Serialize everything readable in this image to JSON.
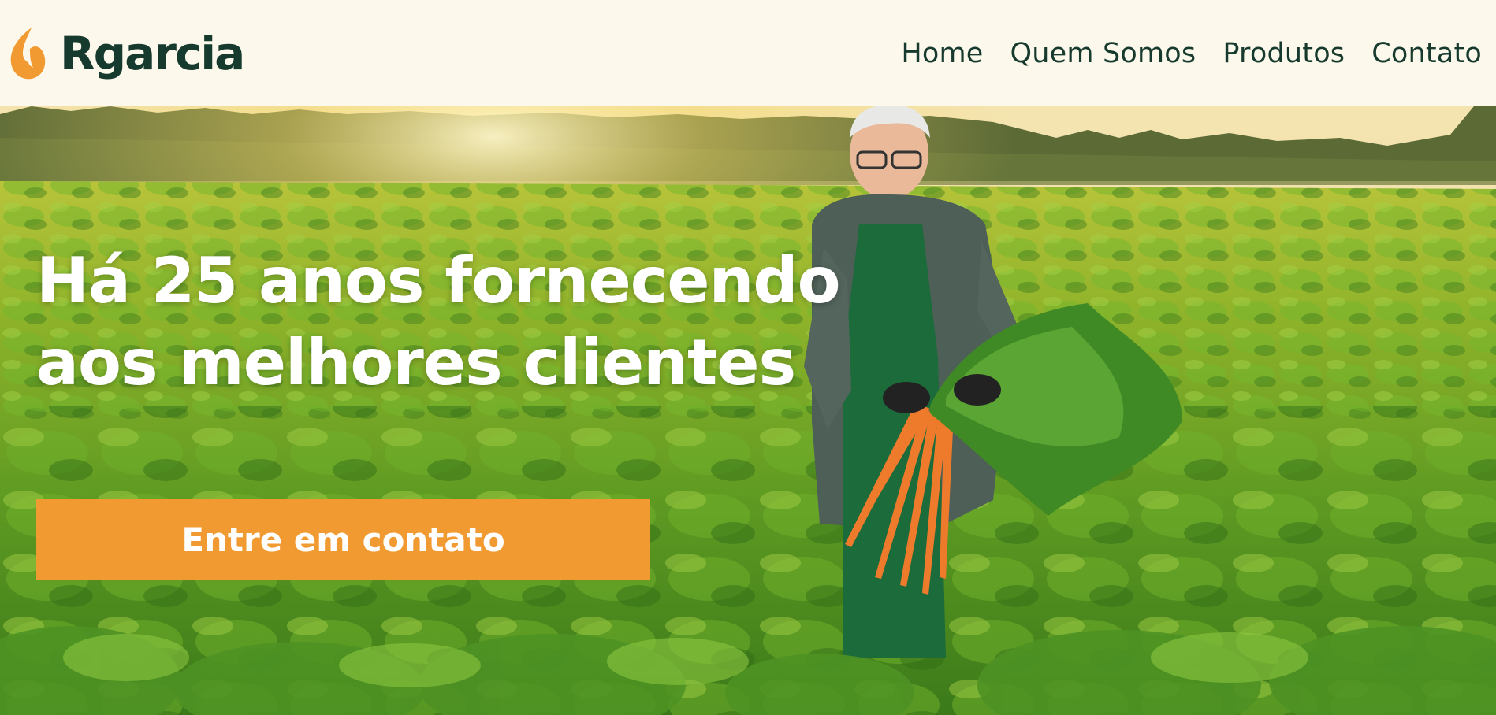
{
  "brand": {
    "name": "Rgarcia",
    "icon": "flame-leaf-icon",
    "icon_color": "#f29a32",
    "text_color": "#163a2d"
  },
  "nav": {
    "items": [
      {
        "label": "Home"
      },
      {
        "label": "Quem Somos"
      },
      {
        "label": "Produtos"
      },
      {
        "label": "Contato"
      }
    ]
  },
  "hero": {
    "title": "Há 25 anos fornecendo aos melhores clientes",
    "cta_label": "Entre em contato",
    "cta_color": "#f29a32"
  },
  "colors": {
    "header_bg": "#fdf8ec",
    "heading_text": "#ffffff"
  }
}
